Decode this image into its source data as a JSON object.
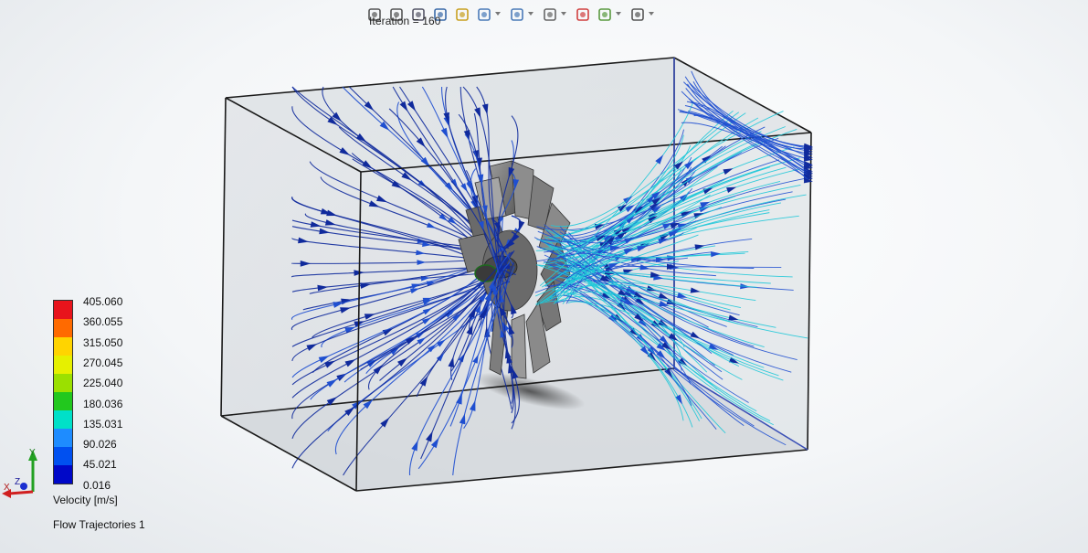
{
  "iteration_label": "Iteration = 160",
  "toolbar": {
    "icons": [
      {
        "name": "zoom-to-fit-icon",
        "drop": false
      },
      {
        "name": "zoom-area-icon",
        "drop": false
      },
      {
        "name": "previous-view-icon",
        "drop": false
      },
      {
        "name": "section-view-icon",
        "drop": false
      },
      {
        "name": "dynamic-annotation-icon",
        "drop": false
      },
      {
        "name": "view-orientation-icon",
        "drop": true
      },
      {
        "name": "display-style-icon",
        "drop": true
      },
      {
        "name": "hide-show-items-icon",
        "drop": true
      },
      {
        "name": "edit-appearance-icon",
        "drop": false
      },
      {
        "name": "apply-scene-icon",
        "drop": true
      },
      {
        "name": "view-settings-icon",
        "drop": true
      }
    ]
  },
  "legend": {
    "values": [
      "405.060",
      "360.055",
      "315.050",
      "270.045",
      "225.040",
      "180.036",
      "135.031",
      "90.026",
      "45.021",
      "0.016"
    ],
    "colors": [
      "#e8141c",
      "#ff6a00",
      "#ffd400",
      "#e6f000",
      "#9be000",
      "#22c81e",
      "#00e0c8",
      "#1e8cff",
      "#0050f0",
      "#0008c8"
    ],
    "title": "Velocity [m/s]"
  },
  "plot_label": "Flow Trajectories 1",
  "triad": {
    "x": "X",
    "y": "Y",
    "z": "Z"
  },
  "colors": {
    "arrow_dark": "#102a9c",
    "arrow_blue": "#1f4fd0",
    "stream_cyan": "#1ec8d8",
    "box_edge": "#1a1a1a",
    "box_fill": "#c9ced4"
  }
}
